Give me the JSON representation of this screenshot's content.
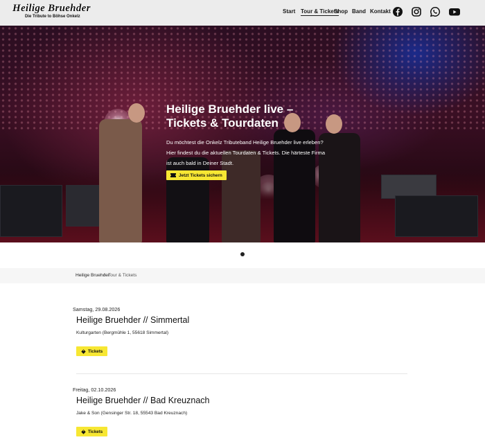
{
  "header": {
    "logo_title": "Heilige Bruehder",
    "logo_subtitle": "Die Tribute to Böhse Onkelz",
    "nav": [
      {
        "label": "Start",
        "active": false
      },
      {
        "label": "Tour & Tickets",
        "active": true
      },
      {
        "label": "Shop",
        "active": false
      },
      {
        "label": "Band",
        "active": false
      },
      {
        "label": "Kontakt",
        "active": false
      }
    ],
    "social_icons": [
      "facebook-icon",
      "instagram-icon",
      "whatsapp-icon",
      "youtube-icon"
    ]
  },
  "hero": {
    "title": "Heilige Bruehder live – Tickets & Tourdaten",
    "text": "Du möchtest die Onkelz Tributeband Heilige Bruehder live erleben? Hier findest du die aktuellen Tourdaten & Tickets. Die härteste Firma ist auch bald in Deiner Stadt.",
    "button_label": "Jetzt Tickets sichern",
    "button_icon": "ticket-icon"
  },
  "breadcrumb": {
    "home": "Heilige Bruehder",
    "separator": "/",
    "current": "Tour & Tickets"
  },
  "events": [
    {
      "date": "Samstag, 29.08.2026",
      "title": "Heilige Bruehder // Simmertal",
      "venue": "Kulturgarten (Bergmühle 1, 55618 Simmertal)",
      "button_label": "Tickets"
    },
    {
      "date": "Freitag, 02.10.2026",
      "title": "Heilige Bruehder // Bad Kreuznach",
      "venue": "Jake & Son (Gensinger Str. 18, 55543 Bad Kreuznach)",
      "button_label": "Tickets"
    }
  ],
  "colors": {
    "accent": "#f7e733",
    "header_bg": "#ececec",
    "breadcrumb_bg": "#f6f6f6"
  }
}
